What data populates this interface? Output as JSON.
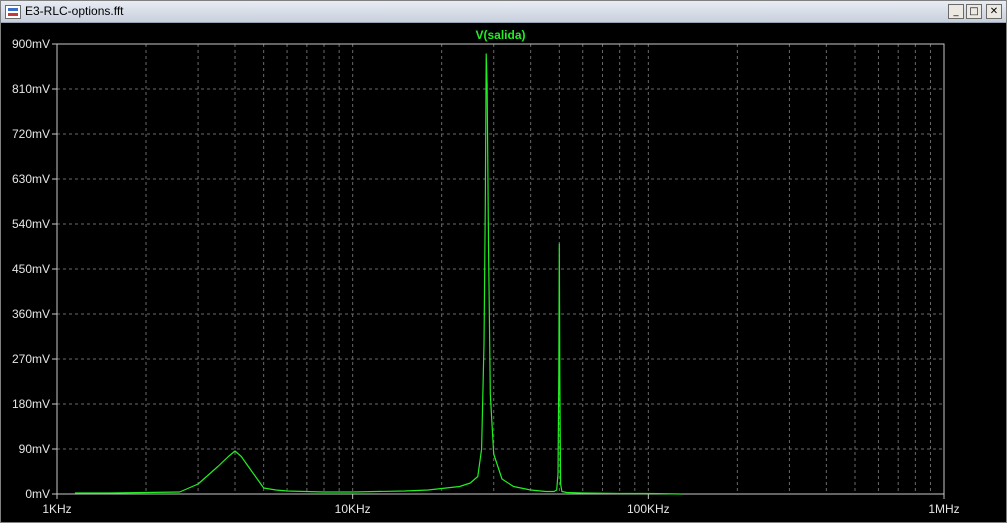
{
  "window": {
    "title": "E3-RLC-options.fft",
    "buttons": {
      "minimize": "_",
      "maximize": "□",
      "close": "✕"
    }
  },
  "colors": {
    "trace": "#22ee22",
    "axis": "#c8c8c8",
    "grid": "#6a6a6a",
    "label": "#e6e6e6",
    "background": "#000000"
  },
  "chart_data": {
    "type": "line",
    "title": "",
    "xlabel": "",
    "ylabel": "",
    "x_scale": "log",
    "xlim": [
      1000,
      1000000
    ],
    "ylim": [
      0,
      900
    ],
    "y_unit": "mV",
    "grid": true,
    "x_ticks": [
      {
        "value": 1000,
        "label": "1KHz"
      },
      {
        "value": 10000,
        "label": "10KHz"
      },
      {
        "value": 100000,
        "label": "100KHz"
      },
      {
        "value": 1000000,
        "label": "1MHz"
      }
    ],
    "y_ticks": [
      {
        "value": 0,
        "label": "0mV"
      },
      {
        "value": 90,
        "label": "90mV"
      },
      {
        "value": 180,
        "label": "180mV"
      },
      {
        "value": 270,
        "label": "270mV"
      },
      {
        "value": 360,
        "label": "360mV"
      },
      {
        "value": 450,
        "label": "450mV"
      },
      {
        "value": 540,
        "label": "540mV"
      },
      {
        "value": 630,
        "label": "630mV"
      },
      {
        "value": 720,
        "label": "720mV"
      },
      {
        "value": 810,
        "label": "810mV"
      },
      {
        "value": 900,
        "label": "900mV"
      }
    ],
    "series": [
      {
        "name": "V(salida)",
        "x": [
          1150,
          1500,
          2000,
          2600,
          3000,
          3500,
          3800,
          4000,
          4200,
          4500,
          5000,
          5500,
          6000,
          8000,
          10000,
          12000,
          15000,
          18000,
          20000,
          23000,
          25000,
          26500,
          27300,
          27800,
          28100,
          28300,
          28500,
          28800,
          29200,
          30000,
          32000,
          35000,
          40000,
          45000,
          48000,
          49000,
          49500,
          49800,
          50000,
          50200,
          50500,
          51000,
          53000,
          60000,
          80000,
          100000,
          130000
        ],
        "y": [
          2,
          2,
          3,
          4,
          20,
          55,
          75,
          86,
          75,
          50,
          12,
          8,
          6,
          4,
          4,
          5,
          6,
          8,
          11,
          15,
          22,
          35,
          90,
          300,
          580,
          880,
          820,
          500,
          200,
          80,
          30,
          15,
          8,
          5,
          5,
          8,
          40,
          240,
          500,
          240,
          20,
          5,
          3,
          2,
          1,
          1,
          0
        ]
      }
    ]
  }
}
